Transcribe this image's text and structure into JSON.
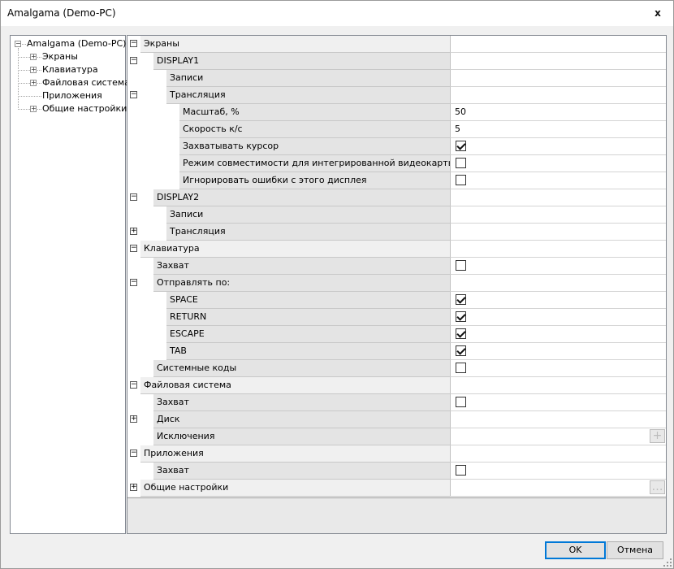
{
  "window": {
    "title": "Amalgama (Demo-PC)",
    "close_glyph": "x"
  },
  "tree": {
    "root": "Amalgama (Demo-PC)",
    "items": [
      "Экраны",
      "Клавиатура",
      "Файловая система",
      "Приложения",
      "Общие настройки"
    ]
  },
  "grid": {
    "rows": [
      {
        "label": "Экраны",
        "level": 0,
        "toggle": "−",
        "kind": "category"
      },
      {
        "label": "DISPLAY1",
        "level": 1,
        "toggle": "−",
        "kind": "category"
      },
      {
        "label": "Записи",
        "level": 2,
        "toggle": "",
        "kind": "prop"
      },
      {
        "label": "Трансляция",
        "level": 2,
        "toggle": "−",
        "kind": "prop"
      },
      {
        "label": "Масштаб, %",
        "level": 3,
        "toggle": "",
        "kind": "prop",
        "value": "50"
      },
      {
        "label": "Скорость к/с",
        "level": 3,
        "toggle": "",
        "kind": "prop",
        "value": "5"
      },
      {
        "label": "Захватывать курсор",
        "level": 3,
        "toggle": "",
        "kind": "prop",
        "checkbox": true
      },
      {
        "label": "Режим совместимости для интегрированной видеокарты",
        "level": 3,
        "toggle": "",
        "kind": "prop",
        "checkbox": false
      },
      {
        "label": "Игнорировать ошибки с этого дисплея",
        "level": 3,
        "toggle": "",
        "kind": "prop",
        "checkbox": false
      },
      {
        "label": "DISPLAY2",
        "level": 1,
        "toggle": "−",
        "kind": "category"
      },
      {
        "label": "Записи",
        "level": 2,
        "toggle": "",
        "kind": "prop"
      },
      {
        "label": "Трансляция",
        "level": 2,
        "toggle": "+",
        "kind": "prop"
      },
      {
        "label": "Клавиатура",
        "level": 0,
        "toggle": "−",
        "kind": "category"
      },
      {
        "label": "Захват",
        "level": 1,
        "toggle": "",
        "kind": "prop",
        "checkbox": false
      },
      {
        "label": "Отправлять по:",
        "level": 1,
        "toggle": "−",
        "kind": "category"
      },
      {
        "label": "SPACE",
        "level": 2,
        "toggle": "",
        "kind": "prop",
        "checkbox": true
      },
      {
        "label": "RETURN",
        "level": 2,
        "toggle": "",
        "kind": "prop",
        "checkbox": true
      },
      {
        "label": "ESCAPE",
        "level": 2,
        "toggle": "",
        "kind": "prop",
        "checkbox": true
      },
      {
        "label": "TAB",
        "level": 2,
        "toggle": "",
        "kind": "prop",
        "checkbox": true
      },
      {
        "label": "Системные коды",
        "level": 1,
        "toggle": "",
        "kind": "prop",
        "checkbox": false
      },
      {
        "label": "Файловая система",
        "level": 0,
        "toggle": "−",
        "kind": "category"
      },
      {
        "label": "Захват",
        "level": 1,
        "toggle": "",
        "kind": "prop",
        "checkbox": false
      },
      {
        "label": "Диск",
        "level": 1,
        "toggle": "+",
        "kind": "prop"
      },
      {
        "label": "Исключения",
        "level": 1,
        "toggle": "",
        "kind": "prop",
        "button": "plus-icon"
      },
      {
        "label": "Приложения",
        "level": 0,
        "toggle": "−",
        "kind": "category"
      },
      {
        "label": "Захват",
        "level": 1,
        "toggle": "",
        "kind": "prop",
        "checkbox": false
      },
      {
        "label": "Общие настройки",
        "level": 0,
        "toggle": "+",
        "kind": "category",
        "button": "ellipsis-icon"
      }
    ]
  },
  "buttons": {
    "ok": "OK",
    "cancel": "Отмена"
  }
}
